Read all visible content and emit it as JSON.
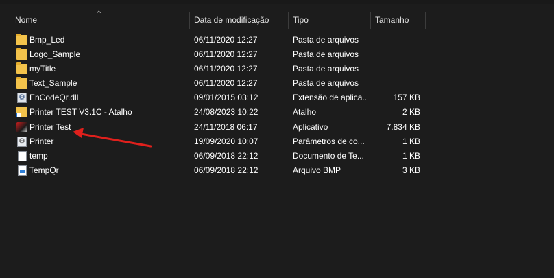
{
  "columns": {
    "name": "Nome",
    "date": "Data de modificação",
    "type": "Tipo",
    "size": "Tamanho"
  },
  "files": [
    {
      "name": "Bmp_Led",
      "date": "06/11/2020 12:27",
      "type": "Pasta de arquivos",
      "size": "",
      "icon": "folder-icon"
    },
    {
      "name": "Logo_Sample",
      "date": "06/11/2020 12:27",
      "type": "Pasta de arquivos",
      "size": "",
      "icon": "folder-icon"
    },
    {
      "name": "myTitle",
      "date": "06/11/2020 12:27",
      "type": "Pasta de arquivos",
      "size": "",
      "icon": "folder-icon"
    },
    {
      "name": "Text_Sample",
      "date": "06/11/2020 12:27",
      "type": "Pasta de arquivos",
      "size": "",
      "icon": "folder-icon"
    },
    {
      "name": "EnCodeQr.dll",
      "date": "09/01/2015 03:12",
      "type": "Extensão de aplica...",
      "size": "157 KB",
      "icon": "dll-icon"
    },
    {
      "name": "Printer TEST V3.1C - Atalho",
      "date": "24/08/2023 10:22",
      "type": "Atalho",
      "size": "2 KB",
      "icon": "shortcut-icon"
    },
    {
      "name": "Printer Test",
      "date": "24/11/2018 06:17",
      "type": "Aplicativo",
      "size": "7.834 KB",
      "icon": "application-icon"
    },
    {
      "name": "Printer",
      "date": "19/09/2020 10:07",
      "type": "Parâmetros de co...",
      "size": "1 KB",
      "icon": "config-file-icon"
    },
    {
      "name": "temp",
      "date": "06/09/2018 22:12",
      "type": "Documento de Te...",
      "size": "1 KB",
      "icon": "text-file-icon"
    },
    {
      "name": "TempQr",
      "date": "06/09/2018 22:12",
      "type": "Arquivo BMP",
      "size": "3 KB",
      "icon": "bitmap-file-icon"
    }
  ],
  "colors": {
    "background": "#1c1c1c",
    "annotation_arrow": "#e0201c"
  }
}
